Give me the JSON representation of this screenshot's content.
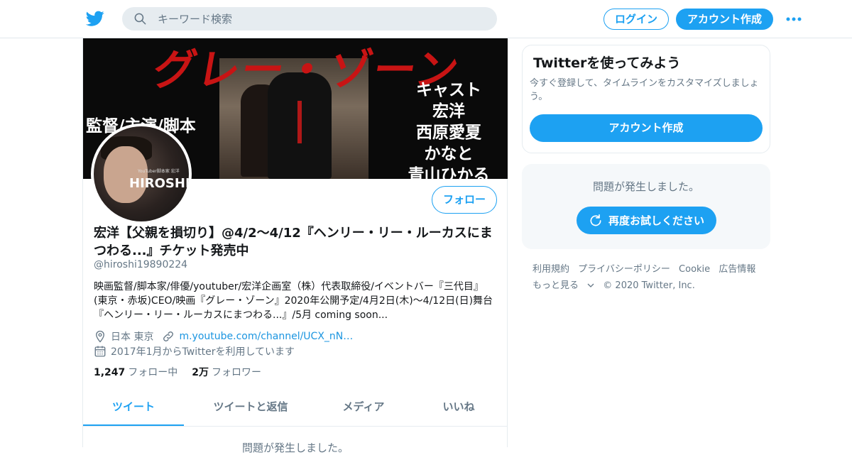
{
  "topbar": {
    "search_placeholder": "キーワード検索",
    "login_label": "ログイン",
    "signup_label": "アカウント作成",
    "icons": [
      "twitter-bird-icon",
      "search-icon",
      "more-dots-icon"
    ]
  },
  "banner": {
    "title": "グレー・ゾーン",
    "left_text": "監督/主演/脚本",
    "cast": [
      "キャスト",
      "宏洋",
      "西原愛夏",
      "かなと",
      "青山ひかる"
    ]
  },
  "avatar": {
    "brand": "HIROSHI",
    "small_text": "YouTuber脚本家 宏洋"
  },
  "profile": {
    "follow_label": "フォロー",
    "name": "宏洋【父親を損切り】@4/2〜4/12『ヘンリー・リー・ルーカスにまつわる...』チケット発売中",
    "handle": "@hiroshi19890224",
    "bio": "映画監督/脚本家/俳優/youtuber/宏洋企画室（株）代表取締役/イベントバー『三代目』(東京・赤坂)CEO/映画『グレー・ゾーン』2020年公開予定/4月2日(木)〜4/12日(日)舞台『ヘンリー・リー・ルーカスにまつわる...』/5月 coming soon...",
    "location": "日本 東京",
    "url": "m.youtube.com/channel/UCX_nN…",
    "joined": "2017年1月からTwitterを利用しています",
    "following_count": "1,247",
    "following_label": "フォロー中",
    "followers_count": "2万",
    "followers_label": "フォロワー"
  },
  "tabs": [
    {
      "label": "ツイート",
      "active": true
    },
    {
      "label": "ツイートと返信",
      "active": false
    },
    {
      "label": "メディア",
      "active": false
    },
    {
      "label": "いいね",
      "active": false
    }
  ],
  "timeline_error": "問題が発生しました。",
  "sidebar": {
    "try_title": "Twitterを使ってみよう",
    "try_desc": "今すぐ登録して、タイムラインをカスタマイズしましょう。",
    "try_button": "アカウント作成",
    "error_msg": "問題が発生しました。",
    "retry_button": "再度お試しください"
  },
  "footer": {
    "links": [
      "利用規約",
      "プライバシーポリシー",
      "Cookie",
      "広告情報",
      "もっと見る"
    ],
    "copyright": "© 2020 Twitter, Inc."
  },
  "colors": {
    "accent": "#1da1f2",
    "secondary_text": "#657786",
    "link": "#1b95e0"
  }
}
